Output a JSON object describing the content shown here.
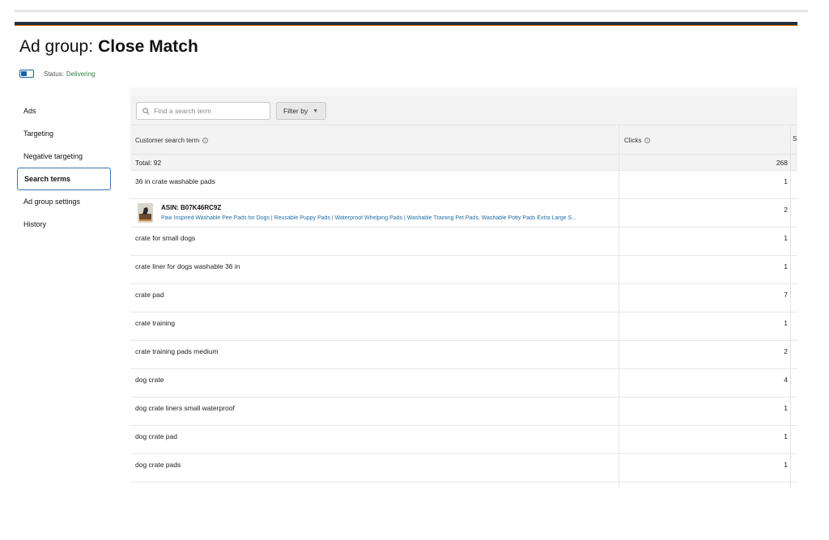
{
  "header": {
    "title_prefix": "Ad group:",
    "title_name": "Close Match",
    "status_label": "Status:",
    "status_value": "Delivering"
  },
  "sidebar": {
    "items": [
      {
        "label": "Ads"
      },
      {
        "label": "Targeting"
      },
      {
        "label": "Negative targeting"
      },
      {
        "label": "Search terms"
      },
      {
        "label": "Ad group settings"
      },
      {
        "label": "History"
      }
    ],
    "active": "Search terms"
  },
  "toolbar": {
    "search_placeholder": "Find a search term",
    "filter_label": "Filter by"
  },
  "table": {
    "columns": {
      "term": "Customer search term",
      "clicks": "Clicks",
      "next": "S"
    },
    "total": {
      "label": "Total: 92",
      "clicks": "268"
    },
    "rows": [
      {
        "term": "36 in crate washable pads",
        "clicks": "1"
      },
      {
        "asin_label": "ASIN: B07K46RC9Z",
        "asin_title": "Paw Inspired Washable Pee Pads for Dogs | Reusable Puppy Pads | Waterproof Whelping Pads | Washable Training Pet Pads, Washable Potty Pads Extra Large S...",
        "clicks": "2"
      },
      {
        "term": "crate for small dogs",
        "clicks": "1"
      },
      {
        "term": "crate liner for dogs washable 36 in",
        "clicks": "1"
      },
      {
        "term": "crate pad",
        "clicks": "7"
      },
      {
        "term": "crate training",
        "clicks": "1"
      },
      {
        "term": "crate training pads medium",
        "clicks": "2"
      },
      {
        "term": "dog crate",
        "clicks": "4"
      },
      {
        "term": "dog crate liners small waterproof",
        "clicks": "1"
      },
      {
        "term": "dog crate pad",
        "clicks": "1"
      },
      {
        "term": "dog crate pads",
        "clicks": "1"
      }
    ]
  },
  "colors": {
    "nav_dark": "#232f3e",
    "accent_orange": "#e77600",
    "status_green": "#2e8540",
    "link_blue": "#1f6fa8",
    "active_border": "#3b73b9"
  },
  "icons": {
    "search": "search-icon",
    "info": "info-icon",
    "toggle": "toggle-switch"
  }
}
